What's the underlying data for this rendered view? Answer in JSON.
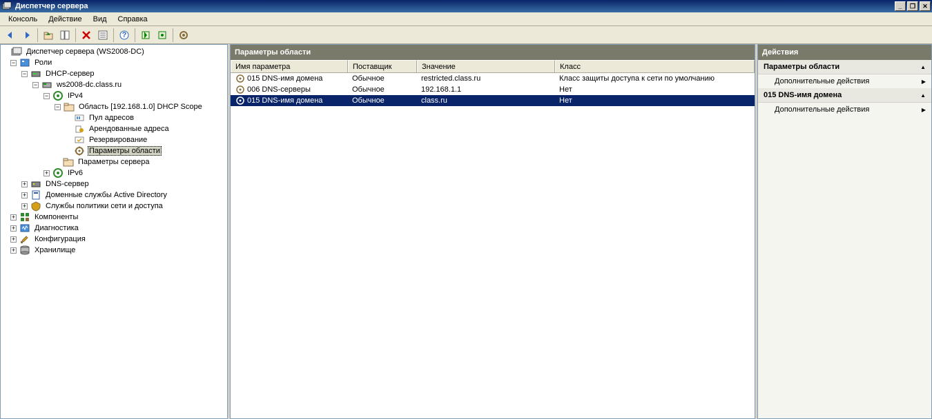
{
  "titlebar": {
    "text": "Диспетчер сервера"
  },
  "menu": {
    "items": [
      "Консоль",
      "Действие",
      "Вид",
      "Справка"
    ]
  },
  "tree": {
    "root": "Диспетчер сервера (WS2008-DC)",
    "roles": "Роли",
    "dhcp": "DHCP-сервер",
    "host": "ws2008-dc.class.ru",
    "ipv4": "IPv4",
    "scope": "Область [192.168.1.0] DHCP Scope",
    "pool": "Пул адресов",
    "leases": "Арендованные адреса",
    "reservations": "Резервирование",
    "scope_options": "Параметры области",
    "server_options": "Параметры сервера",
    "ipv6": "IPv6",
    "dns": "DNS-сервер",
    "adds": "Доменные службы Active Directory",
    "nps": "Службы политики сети и доступа",
    "features": "Компоненты",
    "diagnostics": "Диагностика",
    "configuration": "Конфигурация",
    "storage": "Хранилище"
  },
  "center": {
    "title": "Параметры области",
    "columns": {
      "name": "Имя параметра",
      "vendor": "Поставщик",
      "value": "Значение",
      "class": "Класс"
    },
    "rows": [
      {
        "name": "015 DNS-имя домена",
        "vendor": "Обычное",
        "value": "restricted.class.ru",
        "class": "Класс защиты доступа к сети по умолчанию",
        "selected": false
      },
      {
        "name": "006 DNS-серверы",
        "vendor": "Обычное",
        "value": "192.168.1.1",
        "class": "Нет",
        "selected": false
      },
      {
        "name": "015 DNS-имя домена",
        "vendor": "Обычное",
        "value": "class.ru",
        "class": "Нет",
        "selected": true
      }
    ]
  },
  "right": {
    "title": "Действия",
    "section1": "Параметры области",
    "item1": "Дополнительные действия",
    "section2": "015 DNS-имя домена",
    "item2": "Дополнительные действия"
  }
}
